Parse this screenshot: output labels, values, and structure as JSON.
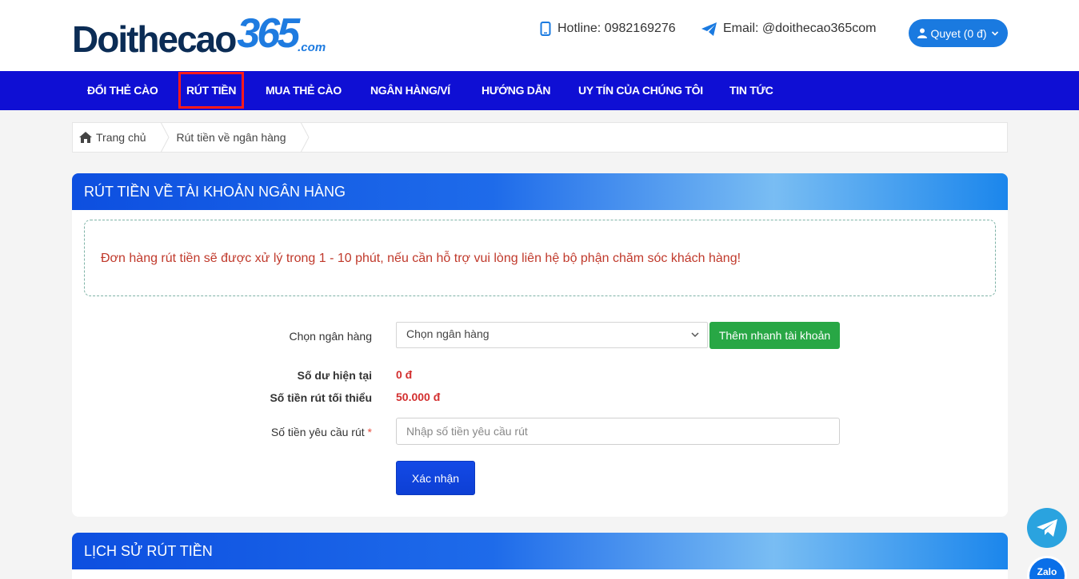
{
  "header": {
    "logo_main": "Doithecao",
    "logo_number": "365",
    "logo_suffix": ".com",
    "hotline": "Hotline: 0982169276",
    "email": "Email: @doithecao365com",
    "user_label": "Quyet (0 đ)"
  },
  "nav": {
    "items": [
      {
        "label": "ĐỔI THẺ CÀO"
      },
      {
        "label": "RÚT TIỀN"
      },
      {
        "label": "MUA THẺ CÀO"
      },
      {
        "label": "NGÂN HÀNG/VÍ"
      },
      {
        "label": "HƯỚNG DẪN"
      },
      {
        "label": "UY TÍN CỦA CHÚNG TÔI"
      },
      {
        "label": "TIN TỨC"
      }
    ]
  },
  "breadcrumb": {
    "home": "Trang chủ",
    "current": "Rút tiền về ngân hàng"
  },
  "withdraw": {
    "title": "RÚT TIỀN VỀ TÀI KHOẢN NGÂN HÀNG",
    "notice": "Đơn hàng rút tiền sẽ được xử lý trong 1 - 10 phút, nếu cần hỗ trợ vui lòng liên hệ bộ phận chăm sóc khách hàng!",
    "bank_label": "Chọn ngân hàng",
    "bank_selected": "Chọn ngân hàng",
    "quick_add": "Thêm nhanh tài khoản",
    "balance_label": "Số dư hiện tại",
    "balance_value": "0 đ",
    "min_label": "Số tiền rút tối thiểu",
    "min_value": "50.000 đ",
    "amount_label": "Số tiền yêu cầu rút",
    "required_mark": "*",
    "amount_placeholder": "Nhập số tiền yêu cầu rút",
    "submit": "Xác nhận"
  },
  "history": {
    "title": "LỊCH SỬ RÚT TIỀN"
  },
  "floating": {
    "zalo_label": "Zalo"
  },
  "colors": {
    "nav_bg": "#0f0fd4",
    "accent": "#1a7ae0",
    "danger": "#d32f2f",
    "success": "#28a745"
  }
}
